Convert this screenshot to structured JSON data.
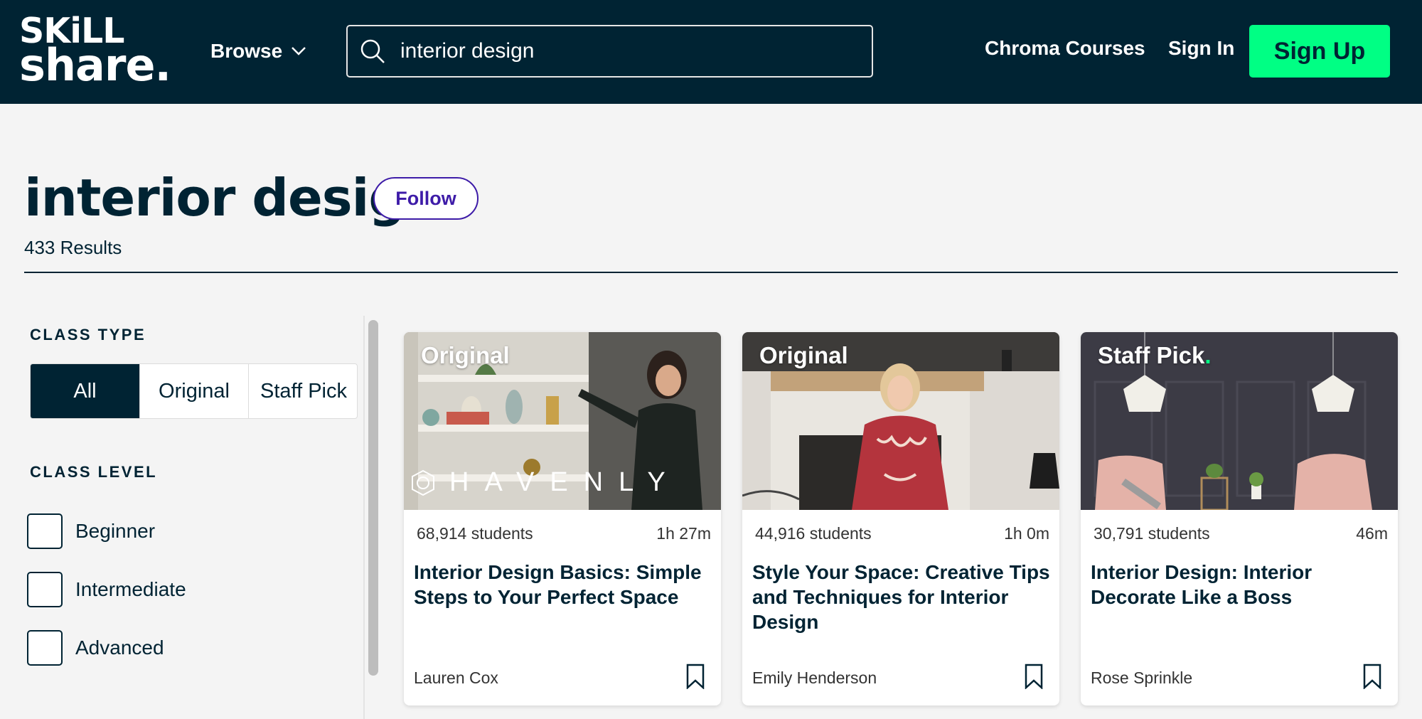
{
  "header": {
    "logo_line1": "SKiLL",
    "logo_line2": "share.",
    "browse_label": "Browse",
    "search_value": "interior design",
    "chroma_label": "Chroma Courses",
    "signin_label": "Sign In",
    "signup_label": "Sign Up"
  },
  "page": {
    "title": "interior design",
    "follow_label": "Follow",
    "results": "433 Results"
  },
  "filters": {
    "class_type_heading": "CLASS TYPE",
    "class_type_options": [
      "All",
      "Original",
      "Staff Pick"
    ],
    "class_type_selected": "All",
    "class_level_heading": "CLASS LEVEL",
    "class_level_options": [
      "Beginner",
      "Intermediate",
      "Advanced"
    ]
  },
  "cards": [
    {
      "badge": "Original",
      "students": "68,914 students",
      "duration": "1h 27m",
      "title": "Interior Design Basics: Simple Steps to Your Perfect Space",
      "teacher": "Lauren Cox",
      "watermark": "HAVENLY"
    },
    {
      "badge": "Original",
      "students": "44,916 students",
      "duration": "1h 0m",
      "title": "Style Your Space: Creative Tips and Techniques for Interior Design",
      "teacher": "Emily Henderson"
    },
    {
      "badge": "Staff Pick",
      "students": "30,791 students",
      "duration": "46m",
      "title": "Interior Design: Interior Decorate Like a Boss",
      "teacher": "Rose Sprinkle"
    }
  ],
  "colors": {
    "navy": "#002333",
    "brand_green": "#00ff84",
    "follow_purple": "#3e1ca8"
  }
}
